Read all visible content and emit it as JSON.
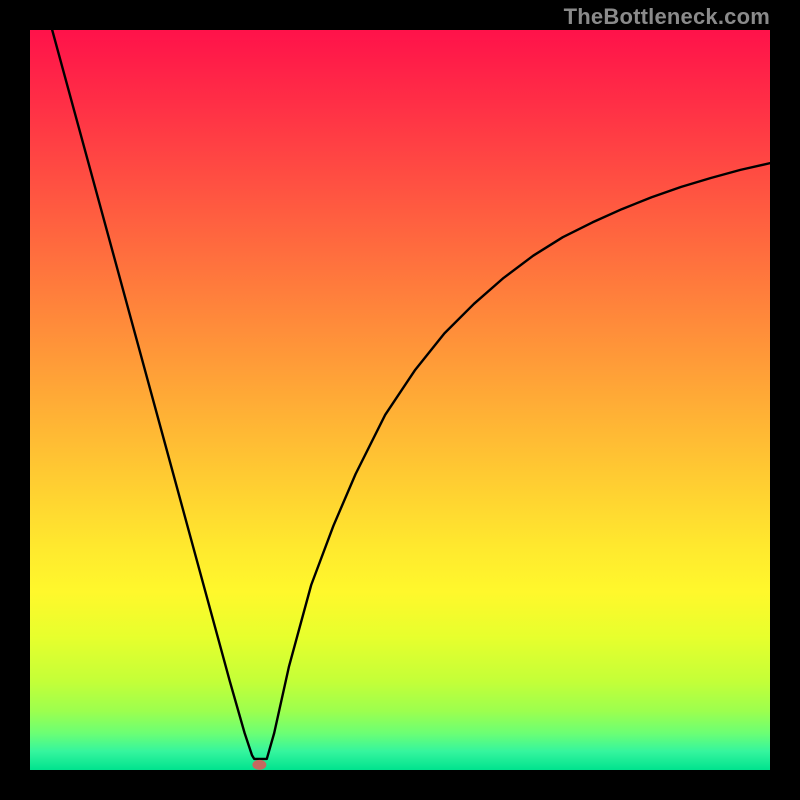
{
  "watermark": "TheBottleneck.com",
  "chart_data": {
    "type": "line",
    "title": "",
    "xlabel": "",
    "ylabel": "",
    "xlim": [
      0,
      100
    ],
    "ylim": [
      0,
      100
    ],
    "grid": false,
    "legend": false,
    "annotations": [
      "optimum marker near x≈31"
    ],
    "series": [
      {
        "name": "left-branch",
        "x": [
          3,
          6,
          9,
          12,
          15,
          18,
          21,
          24,
          27,
          29,
          30,
          30.3,
          30.7
        ],
        "values": [
          100,
          89,
          78,
          67,
          56,
          45,
          34,
          23,
          12,
          5,
          2,
          1.5,
          1.5
        ]
      },
      {
        "name": "bottom-flat",
        "x": [
          30.7,
          32.0
        ],
        "values": [
          1.5,
          1.5
        ]
      },
      {
        "name": "right-branch",
        "x": [
          32.0,
          33,
          35,
          38,
          41,
          44,
          48,
          52,
          56,
          60,
          64,
          68,
          72,
          76,
          80,
          84,
          88,
          92,
          96,
          100
        ],
        "values": [
          1.5,
          5,
          14,
          25,
          33,
          40,
          48,
          54,
          59,
          63,
          66.5,
          69.5,
          72,
          74,
          75.8,
          77.4,
          78.8,
          80,
          81.1,
          82
        ]
      }
    ],
    "optimum_marker": {
      "x": 31,
      "y": 0.7,
      "color": "#c46a5f",
      "rx": 5,
      "ry": 3.5
    },
    "background_gradient": [
      {
        "stop": 0.0,
        "color": "#ff124a"
      },
      {
        "stop": 0.1,
        "color": "#ff2f46"
      },
      {
        "stop": 0.2,
        "color": "#ff4e42"
      },
      {
        "stop": 0.3,
        "color": "#ff6d3e"
      },
      {
        "stop": 0.4,
        "color": "#ff8c3a"
      },
      {
        "stop": 0.5,
        "color": "#ffab36"
      },
      {
        "stop": 0.6,
        "color": "#ffca32"
      },
      {
        "stop": 0.7,
        "color": "#ffe92e"
      },
      {
        "stop": 0.76,
        "color": "#fff82c"
      },
      {
        "stop": 0.82,
        "color": "#e7ff2d"
      },
      {
        "stop": 0.88,
        "color": "#c4ff38"
      },
      {
        "stop": 0.92,
        "color": "#9dff4e"
      },
      {
        "stop": 0.95,
        "color": "#6cff74"
      },
      {
        "stop": 0.975,
        "color": "#35f59e"
      },
      {
        "stop": 1.0,
        "color": "#00e38e"
      }
    ]
  }
}
